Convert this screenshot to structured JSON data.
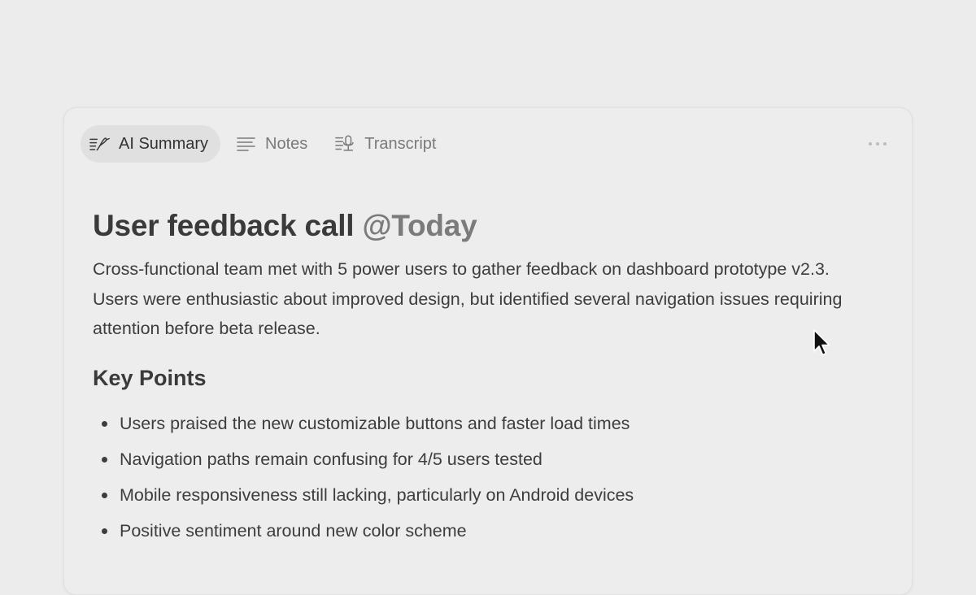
{
  "tabs": [
    {
      "label": "AI Summary",
      "icon": "ai-summary-icon",
      "active": true
    },
    {
      "label": "Notes",
      "icon": "notes-icon",
      "active": false
    },
    {
      "label": "Transcript",
      "icon": "transcript-icon",
      "active": false
    }
  ],
  "more_menu": {
    "icon": "more-horizontal-icon"
  },
  "document": {
    "title": "User feedback call",
    "mention": "@Today",
    "summary": "Cross-functional team met with 5 power users to gather feedback on dashboard prototype v2.3. Users were enthusiastic about improved design, but identified several navigation issues requiring attention before beta release.",
    "key_points_heading": "Key Points",
    "key_points": [
      "Users praised the new customizable buttons and faster load times",
      "Navigation paths remain confusing for 4/5 users tested",
      "Mobile responsiveness still lacking, particularly on Android devices",
      "Positive sentiment around new color scheme"
    ]
  },
  "colors": {
    "background": "#ececec",
    "active_tab": "#e0e0e0",
    "text": "#3d3d3d",
    "muted_text": "#7a7a7a"
  }
}
